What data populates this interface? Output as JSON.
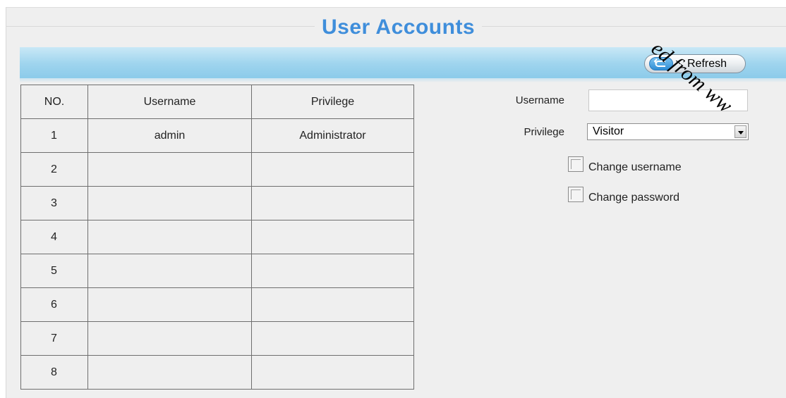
{
  "page": {
    "title": "User Accounts"
  },
  "toolbar": {
    "refresh_label": "Refresh"
  },
  "table": {
    "headers": [
      "NO.",
      "Username",
      "Privilege"
    ],
    "rows": [
      {
        "no": "1",
        "username": "admin",
        "privilege": "Administrator"
      },
      {
        "no": "2",
        "username": "",
        "privilege": ""
      },
      {
        "no": "3",
        "username": "",
        "privilege": ""
      },
      {
        "no": "4",
        "username": "",
        "privilege": ""
      },
      {
        "no": "5",
        "username": "",
        "privilege": ""
      },
      {
        "no": "6",
        "username": "",
        "privilege": ""
      },
      {
        "no": "7",
        "username": "",
        "privilege": ""
      },
      {
        "no": "8",
        "username": "",
        "privilege": ""
      }
    ]
  },
  "form": {
    "username_label": "Username",
    "username_value": "",
    "privilege_label": "Privilege",
    "privilege_value": "Visitor",
    "change_username_label": "Change username",
    "change_username_checked": false,
    "change_password_label": "Change password",
    "change_password_checked": false
  },
  "watermark": "ed from ww",
  "icons": {
    "refresh": "undo-arrow-icon",
    "dropdown": "chevron-down-icon"
  },
  "colors": {
    "title": "#3f8edb",
    "toolbar": "#9ed4ee",
    "panel": "#efefef"
  }
}
